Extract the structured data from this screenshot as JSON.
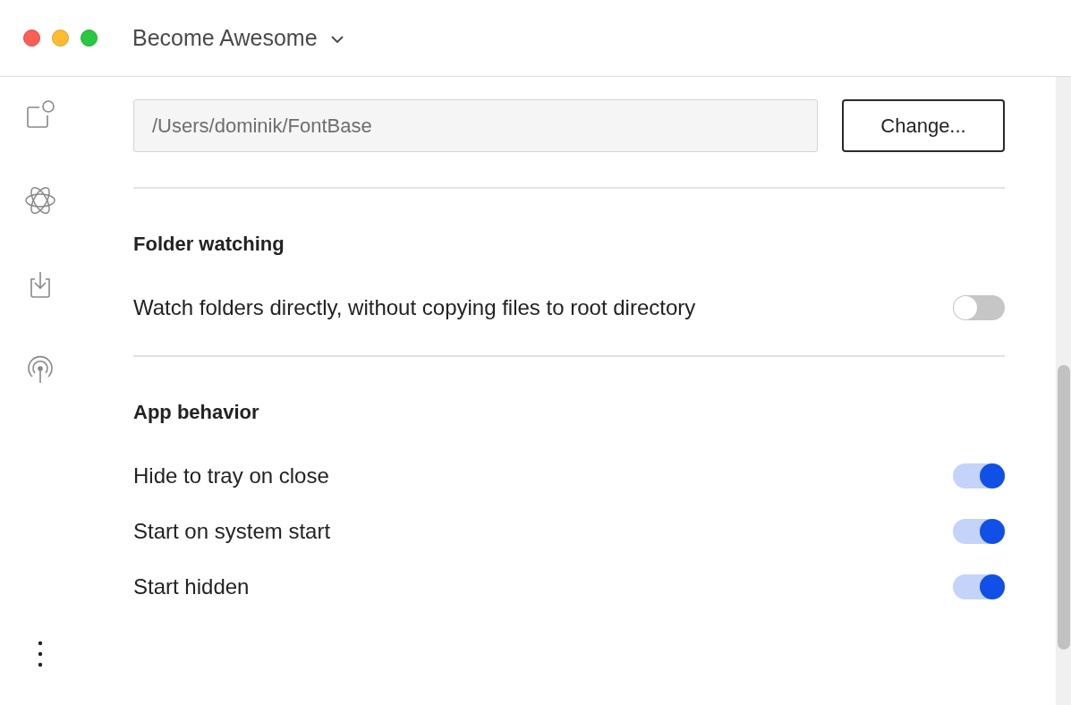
{
  "window": {
    "title": "Become Awesome"
  },
  "sidebar": {
    "items": [
      {
        "kind": "shapes"
      },
      {
        "kind": "atom"
      },
      {
        "kind": "import"
      },
      {
        "kind": "broadcast"
      }
    ]
  },
  "root_directory": {
    "value": "/Users/dominik/FontBase",
    "button": "Change..."
  },
  "sections": [
    {
      "title": "Folder watching",
      "settings": [
        {
          "label": "Watch folders directly, without copying files to root directory",
          "on": false
        }
      ]
    },
    {
      "title": "App behavior",
      "settings": [
        {
          "label": "Hide to tray on close",
          "on": true
        },
        {
          "label": "Start on system start",
          "on": true
        },
        {
          "label": "Start hidden",
          "on": true
        }
      ]
    }
  ]
}
